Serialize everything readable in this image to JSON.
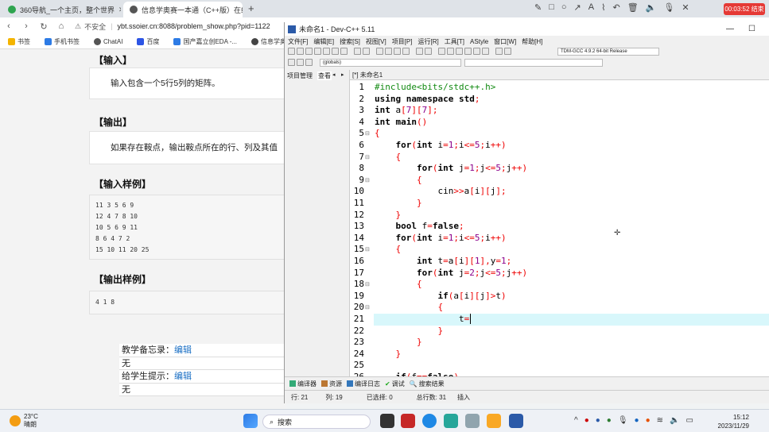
{
  "browser": {
    "tabs": [
      {
        "title": "360导航_一个主页，整个世界",
        "active": false
      },
      {
        "title": "信息学奥赛一本通（C++版）在线...",
        "active": true
      }
    ],
    "address_security": "不安全",
    "address_url": "ybt.ssoier.cn:8088/problem_show.php?pid=1122",
    "bookmarks": [
      "书签",
      "手机书签",
      "ChatAI",
      "百度",
      "国产嘉立创EDA -...",
      "信息学奥赛..."
    ],
    "recording": "00:03:52 结束"
  },
  "problem": {
    "input_title": "【输入】",
    "input_text": "输入包含一个5行5列的矩阵。",
    "output_title": "【输出】",
    "output_text": "如果存在鞍点，输出鞍点所在的行、列及其值",
    "sample_input_title": "【输入样例】",
    "sample_input": [
      "11 3 5 6 9",
      "12 4 7 8 10",
      "10 5 6 9 11",
      "8 6 4 7 2",
      "15 10 11 20 25"
    ],
    "sample_output_title": "【输出样例】",
    "sample_output": "4 1 8",
    "notes": [
      {
        "label": "教学备忘录：",
        "link": "编辑",
        "value": "无"
      },
      {
        "label": "给学生提示：",
        "link": "编辑",
        "value": "无"
      }
    ]
  },
  "devcpp": {
    "title": "未命名1 - Dev-C++ 5.11",
    "menu": [
      "文件[F]",
      "编辑[E]",
      "搜索[S]",
      "视图[V]",
      "项目[P]",
      "运行[R]",
      "工具[T]",
      "AStyle",
      "窗口[W]",
      "帮助[H]"
    ],
    "compiler": "TDM-GCC 4.9.2 64-bit Release",
    "scope": "(globals)",
    "project_label": "项目管理",
    "view_label": "查看",
    "editor_tab": "[*] 未命名1",
    "code": [
      "#include<bits/stdc++.h>",
      "using namespace std;",
      "int a[7][7];",
      "int main()",
      "{",
      "    for(int i=1;i<=5;i++)",
      "    {",
      "        for(int j=1;j<=5;j++)",
      "        {",
      "            cin>>a[i][j];",
      "        }",
      "    }",
      "    bool f=false;",
      "    for(int i=1;i<=5;i++)",
      "    {",
      "        int t=a[i][1],y=1;",
      "        for(int j=2;j<=5;j++)",
      "        {",
      "            if(a[i][j]>t)",
      "            {",
      "                t=",
      "            }",
      "        }",
      "    }",
      "",
      "    if(f==false)"
    ],
    "active_line": 21,
    "bottom_tabs": [
      "编译器",
      "资源",
      "编译日志",
      "调试",
      "搜索结果"
    ],
    "status": {
      "row_label": "行:",
      "row": "21",
      "col_label": "列:",
      "col": "19",
      "sel_label": "已选择:",
      "sel": "0",
      "total_label": "总行数:",
      "total": "31",
      "mode": "插入"
    }
  },
  "taskbar": {
    "weather_temp": "23°C",
    "weather_desc": "晴朗",
    "search_placeholder": "搜索",
    "time": "15:12",
    "date": "2023/11/29"
  }
}
